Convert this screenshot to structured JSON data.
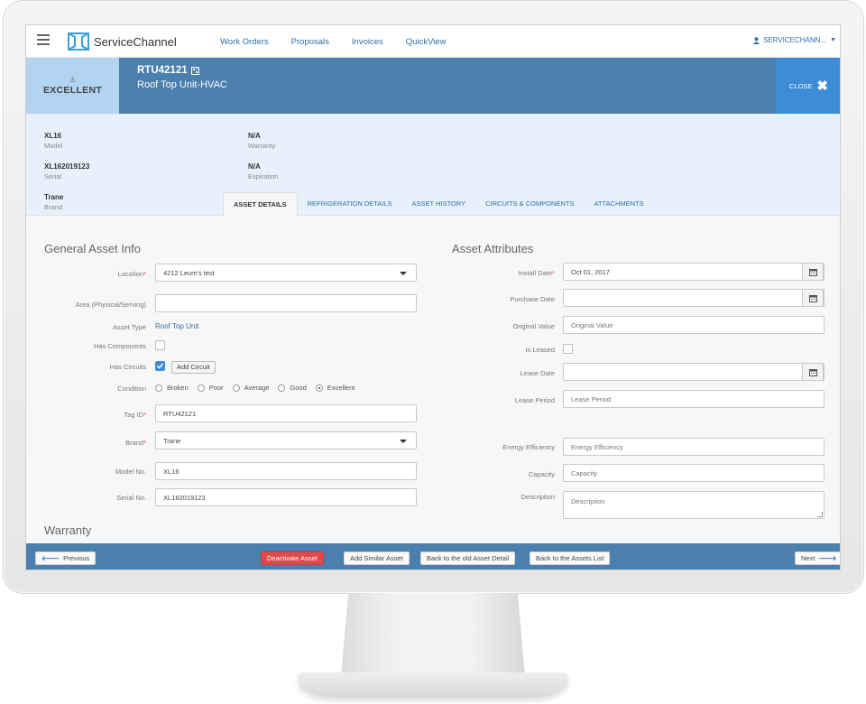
{
  "app": {
    "name": "ServiceChannel",
    "nav": [
      "Work Orders",
      "Proposals",
      "Invoices",
      "QuickView"
    ],
    "user": "SERVICECHANN..."
  },
  "asset": {
    "condition": "EXCELLENT",
    "id": "RTU42121",
    "name": "Roof Top Unit-HVAC",
    "close_label": "CLOSE"
  },
  "summary": {
    "model": {
      "value": "XL16",
      "label": "Model"
    },
    "serial": {
      "value": "XL162019123",
      "label": "Serial"
    },
    "brand": {
      "value": "Trane",
      "label": "Brand"
    },
    "warranty": {
      "value": "N/A",
      "label": "Warranty"
    },
    "expiration": {
      "value": "N/A",
      "label": "Expiration"
    }
  },
  "tabs": [
    "ASSET DETAILS",
    "REFRIGERATION DETAILS",
    "ASSET HISTORY",
    "CIRCUITS & COMPONENTS",
    "ATTACHMENTS"
  ],
  "general": {
    "title": "General Asset Info",
    "location_label": "Location",
    "location_value": "4212 Leum's test",
    "area_label": "Area (Physical/Serving)",
    "area_value": "",
    "asset_type_label": "Asset Type",
    "asset_type_value": "Roof Top Unit",
    "has_components_label": "Has Components",
    "has_circuits_label": "Has Circuits",
    "add_circuit_label": "Add Circuit",
    "condition_label": "Condition",
    "conditions": [
      "Broken",
      "Poor",
      "Average",
      "Good",
      "Excellent"
    ],
    "selected_condition": "Excellent",
    "tag_label": "Tag ID",
    "tag_value": "RTU42121",
    "brand_label": "Brand",
    "brand_value": "Trane",
    "model_label": "Model No.",
    "model_value": "XL16",
    "serial_label": "Serial No.",
    "serial_value": "XL162019123"
  },
  "warranty_title": "Warranty",
  "attributes": {
    "title": "Asset Attributes",
    "install_label": "Install Date",
    "install_value": "Oct 01, 2017",
    "purchase_label": "Purchase Date",
    "purchase_value": "",
    "orig_value_label": "Original Value",
    "orig_value_ph": "Original Value",
    "leased_label": "Is Leased",
    "lease_date_label": "Lease Date",
    "lease_date_value": "",
    "lease_period_label": "Lease Period",
    "lease_period_ph": "Lease Period",
    "energy_label": "Energy Efficiency",
    "energy_ph": "Energy Efficiency",
    "capacity_label": "Capacity",
    "capacity_ph": "Capacity",
    "description_label": "Description",
    "description_ph": "Description"
  },
  "footer": {
    "previous": "Previous",
    "deactivate": "Deactivate Asset",
    "add_similar": "Add Similar Asset",
    "back_old": "Back to the old Asset Detail",
    "back_list": "Back to the Assets List",
    "next": "Next"
  },
  "colors": {
    "header_blue": "#4a7fae",
    "close_blue": "#3e8cd5",
    "condition_bg": "#b2d4f1",
    "danger": "#e04a4a"
  }
}
